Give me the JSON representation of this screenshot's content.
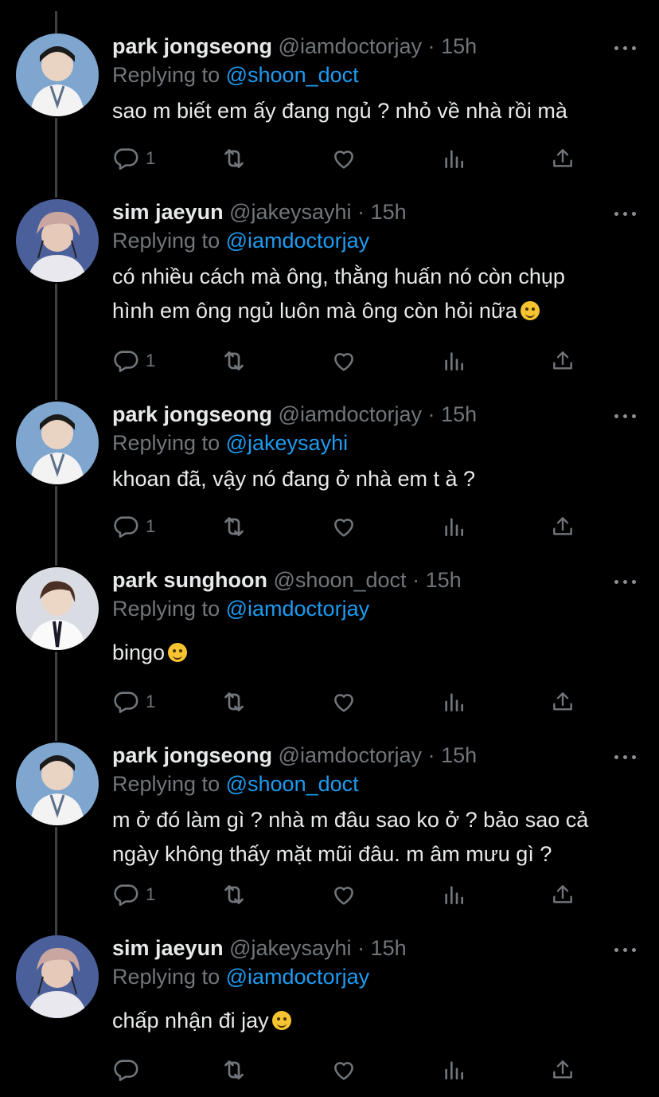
{
  "tweets": [
    {
      "name": "park jongseong",
      "handle": "@iamdoctorjay",
      "dot": "·",
      "time": "15h",
      "replying_prefix": "Replying to",
      "replying_to": "@shoon_doct",
      "lines": [
        "sao m biết em ấy đang ngủ ? nhỏ về nhà rồi mà"
      ],
      "reply_count": "1",
      "avatar": "avatar-jongseong"
    },
    {
      "name": "sim jaeyun",
      "handle": "@jakeysayhi",
      "dot": "·",
      "time": "15h",
      "replying_prefix": "Replying to",
      "replying_to": "@iamdoctorjay",
      "lines": [
        "có nhiều cách mà ông, thằng huấn nó còn chụp",
        "hình em ông ngủ luôn mà ông còn hỏi nữa"
      ],
      "emoji": "grinning-sweat-emoji",
      "reply_count": "1",
      "avatar": "avatar-jaeyun"
    },
    {
      "name": "park jongseong",
      "handle": "@iamdoctorjay",
      "dot": "·",
      "time": "15h",
      "replying_prefix": "Replying to",
      "replying_to": "@jakeysayhi",
      "lines": [
        "khoan đã, vậy nó đang ở nhà em t à ?"
      ],
      "reply_count": "1",
      "avatar": "avatar-jongseong"
    },
    {
      "name": "park sunghoon",
      "handle": "@shoon_doct",
      "dot": "·",
      "time": "15h",
      "replying_prefix": "Replying to",
      "replying_to": "@iamdoctorjay",
      "lines": [
        "bingo"
      ],
      "emoji": "yum-emoji",
      "reply_count": "1",
      "avatar": "avatar-sunghoon"
    },
    {
      "name": "park jongseong",
      "handle": "@iamdoctorjay",
      "dot": "·",
      "time": "15h",
      "replying_prefix": "Replying to",
      "replying_to": "@shoon_doct",
      "lines": [
        "m ở đó làm gì ? nhà m đâu sao ko ở ? bảo sao cả",
        "ngày không thấy mặt mũi đâu. m âm mưu gì ?"
      ],
      "reply_count": "1",
      "avatar": "avatar-jongseong"
    },
    {
      "name": "sim jaeyun",
      "handle": "@jakeysayhi",
      "dot": "·",
      "time": "15h",
      "replying_prefix": "Replying to",
      "replying_to": "@iamdoctorjay",
      "lines": [
        "chấp nhận đi jay"
      ],
      "emoji": "pensive-emoji",
      "reply_count": "",
      "avatar": "avatar-jaeyun"
    }
  ],
  "colors": {
    "background": "#000000",
    "name": "#e7e9ea",
    "secondary": "#71767b",
    "mention": "#1d9bf0",
    "thread_line": "#3e4144"
  },
  "icons": [
    "reply-icon",
    "retweet-icon",
    "like-icon",
    "views-icon",
    "share-icon",
    "more-icon"
  ]
}
